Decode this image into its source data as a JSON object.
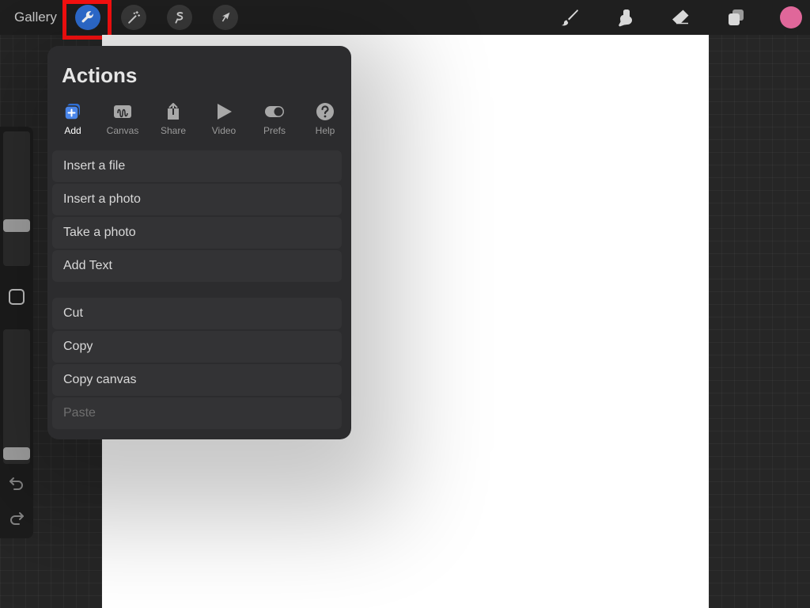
{
  "topbar": {
    "gallery_label": "Gallery",
    "tools_left": [
      "wrench-icon",
      "magic-wand-icon",
      "selection-icon",
      "transform-arrow-icon"
    ],
    "tools_right": [
      "brush-icon",
      "smudge-icon",
      "eraser-icon",
      "layers-icon"
    ],
    "active_tool": "actions",
    "color_swatch": "#e0679a",
    "accent_color": "#2f6fd6",
    "highlight_color": "#ff1010"
  },
  "actions": {
    "title": "Actions",
    "tabs": [
      {
        "label": "Add",
        "icon": "add-layer-icon",
        "active": true
      },
      {
        "label": "Canvas",
        "icon": "canvas-icon",
        "active": false
      },
      {
        "label": "Share",
        "icon": "share-icon",
        "active": false
      },
      {
        "label": "Video",
        "icon": "play-icon",
        "active": false
      },
      {
        "label": "Prefs",
        "icon": "toggle-icon",
        "active": false
      },
      {
        "label": "Help",
        "icon": "help-icon",
        "active": false
      }
    ],
    "group1": [
      {
        "label": "Insert a file"
      },
      {
        "label": "Insert a photo"
      },
      {
        "label": "Take a photo"
      },
      {
        "label": "Add Text"
      }
    ],
    "group2": [
      {
        "label": "Cut"
      },
      {
        "label": "Copy"
      },
      {
        "label": "Copy canvas"
      },
      {
        "label": "Paste",
        "disabled": true
      }
    ]
  },
  "sidebar": {
    "brush_size_level": 0.28,
    "opacity_level": 0.03
  }
}
